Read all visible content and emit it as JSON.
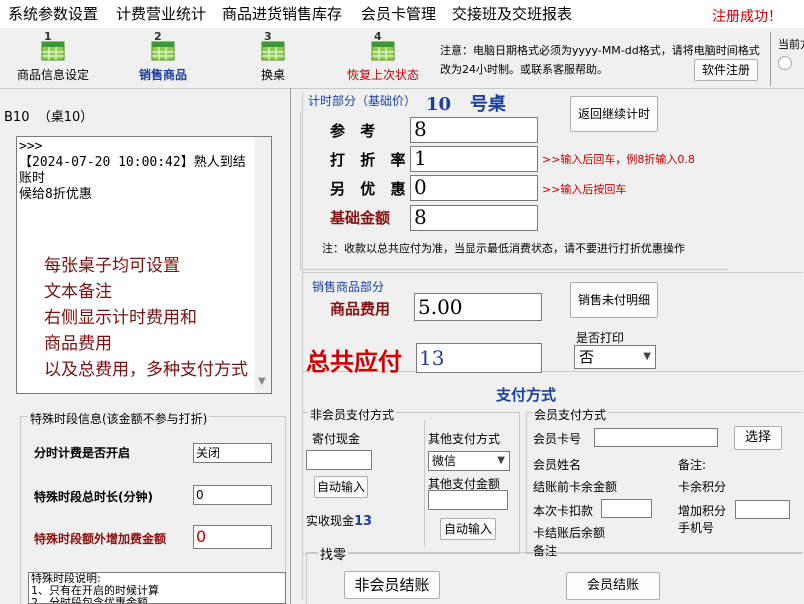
{
  "menu": {
    "items": [
      "系统参数设置",
      "计费营业统计",
      "商品进货销售库存",
      "会员卡管理",
      "交接班及交班报表"
    ],
    "status": "注册成功！"
  },
  "toolbar": {
    "tools": [
      "商品信息设定",
      "销售商品",
      "换桌",
      "恢复上次状态"
    ],
    "tool_numbers": [
      "1",
      "2",
      "3",
      "4"
    ],
    "note": "注意：电脑日期格式必须为yyyy-MM-dd格式，请将电脑时间格式改为24小时制。或联系客服帮助。",
    "register": "软件注册",
    "side_label": "当前方"
  },
  "left": {
    "table_title": "B10  （桌10）",
    "log": ">>>\n【2024-07-20 10:00:42】熟人到结账时\n候给8折优惠",
    "overlay": "每张桌子均可设置\n文本备注\n右侧显示计时费用和\n商品费用\n以及总费用，多种支付方式",
    "special_title": "特殊时段信息(该金额不参与打折)",
    "special_enable_label": "分时计费是否开启",
    "special_enable_value": "关闭",
    "special_duration_label": "特殊时段总时长(分钟)",
    "special_duration_value": "0",
    "special_extra_label": "特殊时段额外增加费金额",
    "special_extra_value": "0",
    "special_note": "特殊时段说明:\n1、只有在开启的时候计算\n2、分时段包含优惠金额"
  },
  "timing": {
    "section_label": "计时部分（基础价）",
    "table_no": "10   号桌",
    "return_button": "返回继续计时",
    "ref_label": "参  考",
    "ref_value": "8",
    "discount_label": "打 折 率",
    "discount_value": "1",
    "discount_hint": ">>输入后回车，例8折输入0.8",
    "extra_label": "另 优 惠",
    "extra_value": "0",
    "extra_hint": ">>输入后按回车",
    "base_label": "基础金额",
    "base_value": "8",
    "notice": "注：收款以总共应付为准，当显示最低消费状态，请不要进行打折优惠操作"
  },
  "goods": {
    "section_label": "销售商品部分",
    "fee_label": "商品费用",
    "fee_value": "5.00",
    "detail_button": "销售未付明细"
  },
  "total": {
    "label": "总共应付",
    "value": "13",
    "print_label": "是否打印",
    "print_value": "否"
  },
  "payment": {
    "title": "支付方式",
    "nonmember_group": "非会员支付方式",
    "cash_label": "寄付现金",
    "auto_input1": "自动输入",
    "actual_cash_label": "实收现金",
    "actual_cash_value": "13",
    "change_label": "找零",
    "other_label": "其他支付方式",
    "other_value": "微信",
    "other_amount_label": "其他支付金额",
    "auto_input2": "自动输入",
    "member_group": "会员支付方式",
    "card_label": "会员卡号",
    "select_button": "选择",
    "name_label": "会员姓名",
    "remark_label": "备注:",
    "balance_before": "结账前卡余金额",
    "points_label": "卡余积分",
    "deduct_label": "本次卡扣款",
    "add_points_label": "增加积分",
    "phone_label": "手机号",
    "balance_after": "卡结账后余额",
    "remark2": "备注",
    "nonmember_checkout": "非会员结账",
    "member_checkout": "会员结账"
  }
}
